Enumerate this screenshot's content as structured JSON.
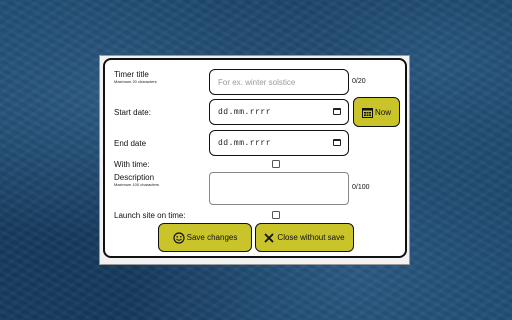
{
  "form": {
    "title": {
      "label": "Timer title",
      "hint": "Maximum 20 characters",
      "placeholder": "For ex. winter solstice",
      "counter": "0/20"
    },
    "start_date": {
      "label": "Start date:",
      "value": "dd.mm.rrrr",
      "now_label": "Now"
    },
    "end_date": {
      "label": "End date",
      "value": "dd.mm.rrrr"
    },
    "with_time": {
      "label": "With time:"
    },
    "description": {
      "label": "Description",
      "hint": "Maximum 100 characters",
      "counter": "0/100"
    },
    "launch": {
      "label": "Launch site on time:"
    },
    "save_label": "Save changes",
    "close_label": "Close without save"
  },
  "colors": {
    "accent": "#c8c42a",
    "background": "#1f4d73"
  }
}
